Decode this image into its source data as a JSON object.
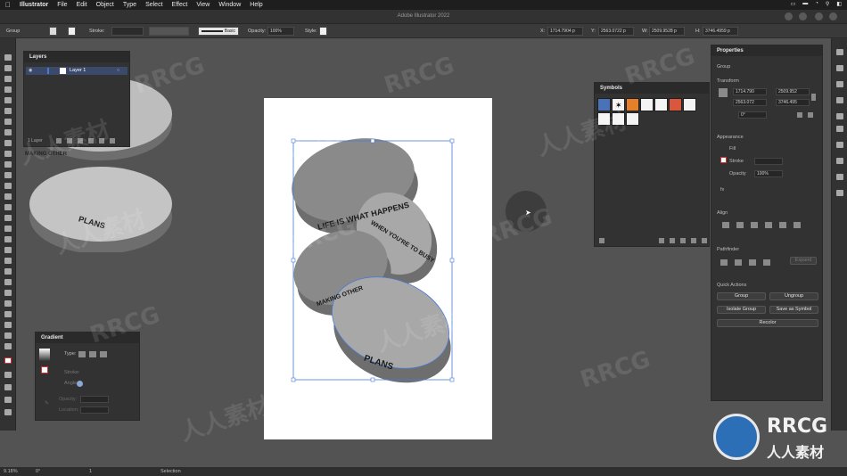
{
  "menubar": {
    "app_name": "Illustrator",
    "items": [
      "File",
      "Edit",
      "Object",
      "Type",
      "Select",
      "Effect",
      "View",
      "Window",
      "Help"
    ]
  },
  "window": {
    "title": "Adobe Illustrator 2022"
  },
  "control_bar": {
    "selection_type": "Group",
    "stroke_label": "Stroke:",
    "brush": "Basic",
    "opacity_label": "Opacity:",
    "opacity_value": "100%",
    "style_label": "Style:",
    "x_label": "X:",
    "x_value": "1714.7904 p",
    "y_label": "Y:",
    "y_value": "2563.0722 p",
    "w_label": "W:",
    "w_value": "2509.9528 p",
    "h_label": "H:",
    "h_value": "3746.4959 p"
  },
  "layers_panel": {
    "title": "Layers",
    "layer_name": "Layer 1",
    "footer": "1 Layer"
  },
  "symbols_panel": {
    "title": "Symbols"
  },
  "gradient_panel": {
    "title": "Gradient",
    "type_label": "Type:",
    "stroke_label": "Stroke:",
    "angle_label": "Angle:",
    "opacity_label": "Opacity:",
    "location_label": "Location:"
  },
  "properties_panel": {
    "title": "Properties",
    "group_label": "Group",
    "transform_label": "Transform",
    "x_value": "1714.790",
    "y_value": "2563.072",
    "w_value": "2509.952",
    "h_value": "3746.495",
    "rotation_value": "0°",
    "appearance_label": "Appearance",
    "fill_label": "Fill",
    "stroke_label": "Stroke",
    "opacity_label": "Opacity",
    "opacity_value": "100%",
    "fx_label": "fx",
    "align_label": "Align",
    "pathfinder_label": "Pathfinder",
    "expand_label": "Expand",
    "quick_actions_label": "Quick Actions",
    "buttons": [
      "Group",
      "Ungroup",
      "Isolate Group",
      "Save as Symbol",
      "Recolor"
    ]
  },
  "artwork": {
    "pill_texts": [
      "LIFE IS WHAT HAPPENS",
      "WHEN YOU'RE TO BUSY",
      "MAKING OTHER",
      "PLANS"
    ],
    "offcanvas_text": "PLANS",
    "offcanvas_text_top": "MAKING OTHER",
    "fill_color": "#8a8a8a",
    "side_color": "#6e6e6e",
    "selection_color": "#4a7bd4"
  },
  "status_bar": {
    "zoom": "9.18%",
    "rotation": "0°",
    "artboard": "1",
    "tool": "Selection"
  },
  "watermarks": {
    "brand": "RRCG",
    "chinese": "人人素材"
  }
}
